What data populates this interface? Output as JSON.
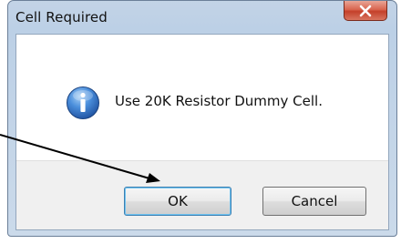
{
  "dialog": {
    "title": "Cell Required",
    "close_icon": "close-x-icon",
    "message_icon": "information-icon",
    "message": "Use 20K Resistor Dummy Cell.",
    "buttons": {
      "ok_label": "OK",
      "cancel_label": "Cancel"
    }
  },
  "annotation": {
    "pointer": "arrow-pointing-to-ok-button"
  },
  "colors": {
    "close_button": "#c4402a",
    "info_icon": "#2a64b4",
    "focus_ring": "#3c7fb1"
  }
}
